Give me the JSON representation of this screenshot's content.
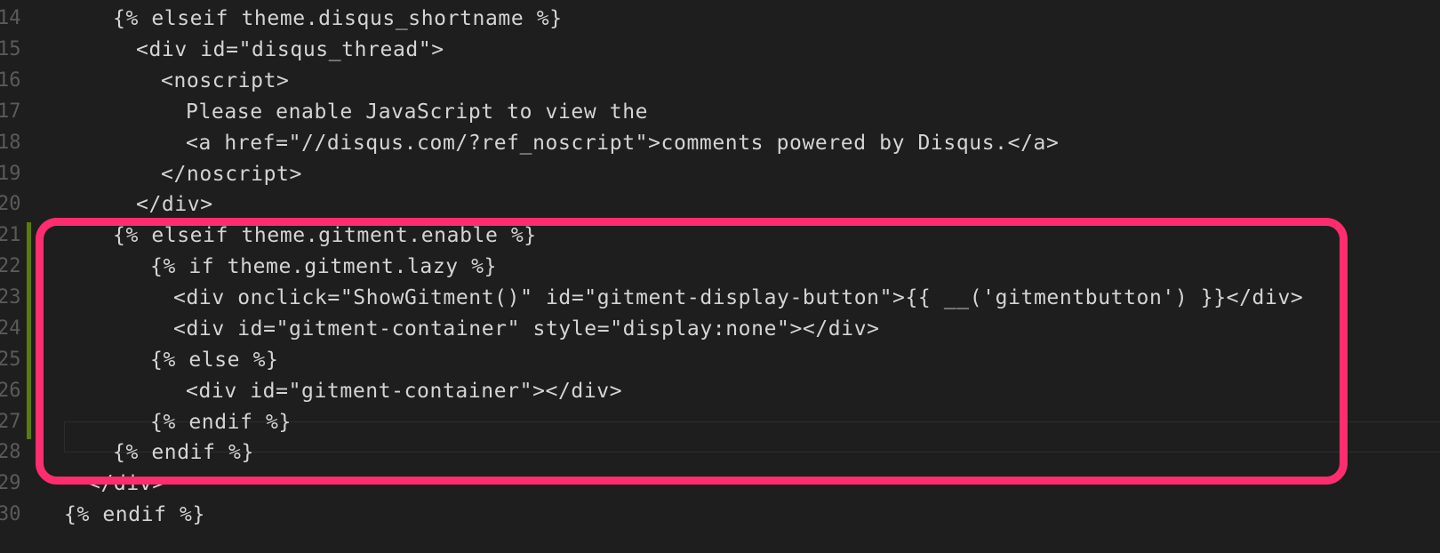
{
  "editor": {
    "lines": [
      {
        "num": "14",
        "indent": 5,
        "code": "{% elseif theme.disqus_shortname %}"
      },
      {
        "num": "15",
        "indent": 6,
        "code": "<div id=\"disqus_thread\">"
      },
      {
        "num": "16",
        "indent": 7,
        "code": "<noscript>"
      },
      {
        "num": "17",
        "indent": 8,
        "code": "Please enable JavaScript to view the"
      },
      {
        "num": "18",
        "indent": 8,
        "code": "<a href=\"//disqus.com/?ref_noscript\">comments powered by Disqus.</a>"
      },
      {
        "num": "19",
        "indent": 7,
        "code": "</noscript>"
      },
      {
        "num": "20",
        "indent": 6,
        "code": "</div>"
      },
      {
        "num": "21",
        "indent": 5,
        "code": "{% elseif theme.gitment.enable %}"
      },
      {
        "num": "22",
        "indent": 7,
        "code": "{% if theme.gitment.lazy %}"
      },
      {
        "num": "23",
        "indent": 8,
        "code": "<div onclick=\"ShowGitment()\" id=\"gitment-display-button\">{{ __('gitmentbutton') }}</div>"
      },
      {
        "num": "24",
        "indent": 8,
        "code": "<div id=\"gitment-container\" style=\"display:none\"></div>"
      },
      {
        "num": "25",
        "indent": 7,
        "code": "{% else %}"
      },
      {
        "num": "26",
        "indent": 8,
        "code": "<div id=\"gitment-container\"></div>"
      },
      {
        "num": "27",
        "indent": 7,
        "code": "{% endif %}"
      },
      {
        "num": "28",
        "indent": 5,
        "code": "{% endif %}"
      },
      {
        "num": "29",
        "indent": 4,
        "code": "</div>"
      },
      {
        "num": "30",
        "indent": 3,
        "code": "{% endif %}"
      }
    ]
  },
  "colors": {
    "background": "#1e1e1e",
    "text": "#d4d4d4",
    "line_number": "#5a5a5a",
    "highlight_border": "#ff2d6f",
    "git_added": "#587c0c"
  }
}
